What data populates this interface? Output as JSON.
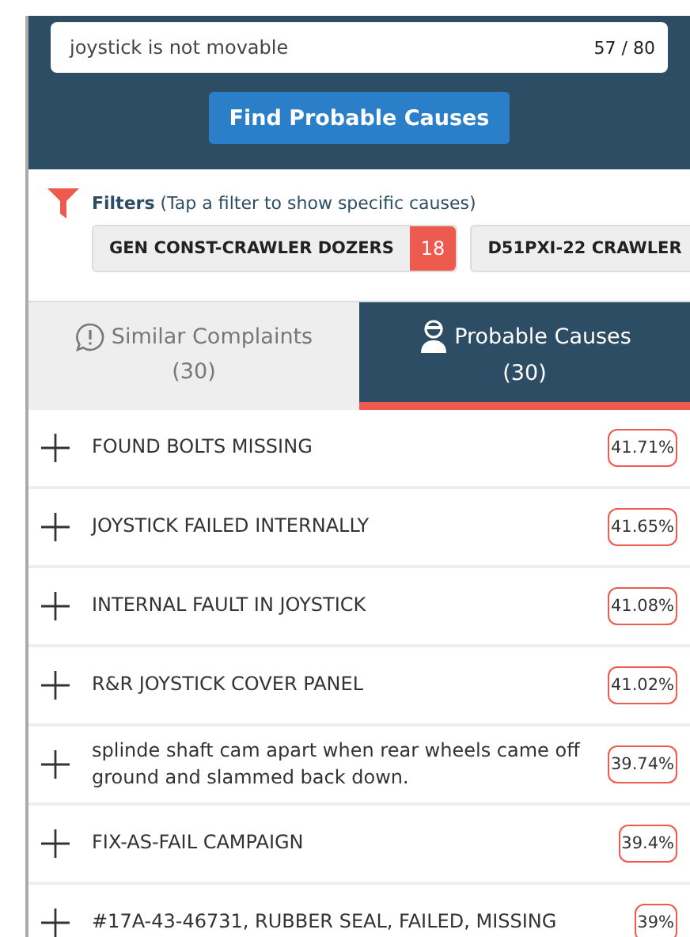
{
  "search": {
    "value": "joystick is not movable",
    "counter": "57 / 80"
  },
  "find_button": "Find Probable Causes",
  "filters": {
    "label": "Filters",
    "hint": "(Tap a filter to show specific causes)",
    "chips": [
      {
        "label": "GEN CONST-CRAWLER DOZERS",
        "count": "18"
      },
      {
        "label": "D51PXI-22 CRAWLER"
      }
    ]
  },
  "tabs": [
    {
      "label": "Similar Complaints",
      "count": "(30)",
      "kind": "complaints",
      "selected": false
    },
    {
      "label": "Probable Causes",
      "count": "(30)",
      "kind": "causes",
      "selected": true
    }
  ],
  "causes": [
    {
      "text": "FOUND BOLTS MISSING",
      "score": "41.71%"
    },
    {
      "text": "JOYSTICK FAILED INTERNALLY",
      "score": "41.65%"
    },
    {
      "text": "INTERNAL FAULT IN JOYSTICK",
      "score": "41.08%"
    },
    {
      "text": "R&R JOYSTICK COVER PANEL",
      "score": "41.02%"
    },
    {
      "text": "splinde shaft cam apart when rear wheels came off ground and slammed back down.",
      "score": "39.74%"
    },
    {
      "text": "FIX-AS-FAIL CAMPAIGN",
      "score": "39.4%"
    },
    {
      "text": "#17A-43-46731, RUBBER SEAL, FAILED, MISSING",
      "score": "39%"
    }
  ]
}
